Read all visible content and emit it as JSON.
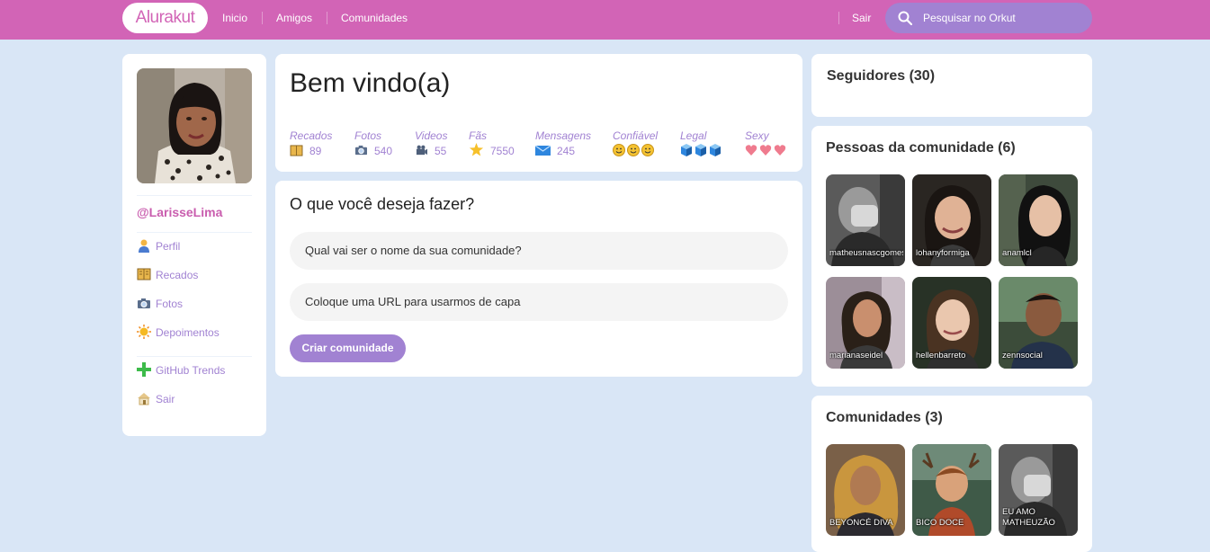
{
  "header": {
    "logo": "Alurakut",
    "nav": [
      "Inicio",
      "Amigos",
      "Comunidades"
    ],
    "logout": "Sair",
    "search_placeholder": "Pesquisar no Orkut",
    "colors": {
      "bar": "#D264B6",
      "search": "#A182D2",
      "page_bg": "#D9E6F6"
    }
  },
  "profile": {
    "username": "@LarisseLima",
    "menu": [
      {
        "label": "Perfil",
        "icon": "user-icon"
      },
      {
        "label": "Recados",
        "icon": "book-icon"
      },
      {
        "label": "Fotos",
        "icon": "camera-icon"
      },
      {
        "label": "Depoimentos",
        "icon": "sun-icon"
      }
    ],
    "menu_bottom": [
      {
        "label": "GitHub Trends",
        "icon": "plus-icon"
      },
      {
        "label": "Sair",
        "icon": "home-icon"
      }
    ]
  },
  "welcome": {
    "title": "Bem vindo(a)",
    "stats": [
      {
        "label": "Recados",
        "value": "89",
        "icon": "book-icon"
      },
      {
        "label": "Fotos",
        "value": "540",
        "icon": "camera-icon"
      },
      {
        "label": "Videos",
        "value": "55",
        "icon": "video-camera-icon"
      },
      {
        "label": "Fãs",
        "value": "7550",
        "icon": "star-icon"
      },
      {
        "label": "Mensagens",
        "value": "245",
        "icon": "envelope-icon"
      },
      {
        "label": "Confiável",
        "level": 3,
        "icon": "smiley-icon"
      },
      {
        "label": "Legal",
        "level": 3,
        "icon": "cube-icon"
      },
      {
        "label": "Sexy",
        "level": 3,
        "icon": "heart-icon"
      }
    ]
  },
  "form": {
    "title": "O que você deseja fazer?",
    "name_placeholder": "Qual vai ser o nome da sua comunidade?",
    "url_placeholder": "Coloque uma URL para usarmos de capa",
    "submit": "Criar comunidade"
  },
  "followers": {
    "title": "Seguidores (30)"
  },
  "people": {
    "title": "Pessoas da comunidade (6)",
    "items": [
      "matheusnascgomes",
      "lohanyformiga",
      "anamlcl",
      "marianaseidel",
      "hellenbarreto",
      "zennsocial"
    ]
  },
  "communities": {
    "title": "Comunidades (3)",
    "items": [
      "BEYONCÉ DIVA",
      "BICO DOCE",
      "EU AMO MATHEUZÃO"
    ]
  }
}
